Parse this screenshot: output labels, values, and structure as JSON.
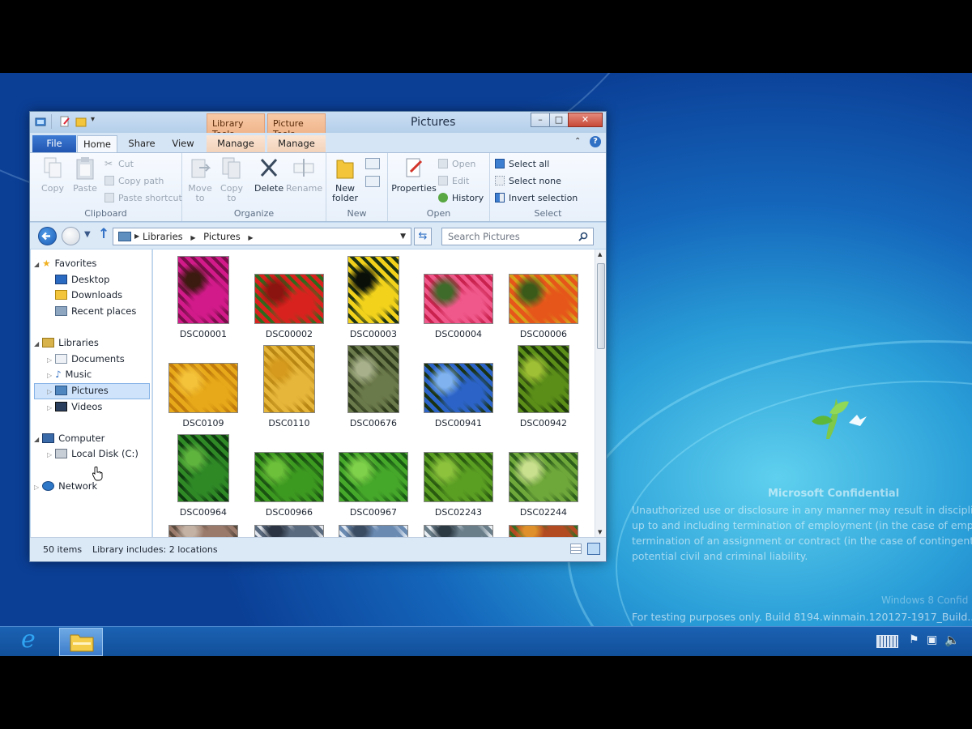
{
  "window": {
    "title": "Pictures",
    "context_tabs": [
      "Library Tools",
      "Picture Tools"
    ],
    "buttons": {
      "minimize": "–",
      "maximize": "□",
      "close": "✕"
    }
  },
  "tabs": {
    "file": "File",
    "home": "Home",
    "share": "Share",
    "view": "View",
    "manage1": "Manage",
    "manage2": "Manage"
  },
  "ribbon": {
    "clipboard": {
      "label": "Clipboard",
      "copy": "Copy",
      "paste": "Paste",
      "cut": "Cut",
      "copy_path": "Copy path",
      "paste_shortcut": "Paste shortcut"
    },
    "organize": {
      "label": "Organize",
      "move_to": "Move to",
      "copy_to": "Copy to",
      "delete": "Delete",
      "rename": "Rename"
    },
    "new": {
      "label": "New",
      "new_folder": "New folder"
    },
    "open": {
      "label": "Open",
      "properties": "Properties",
      "open": "Open",
      "edit": "Edit",
      "history": "History"
    },
    "select": {
      "label": "Select",
      "select_all": "Select all",
      "select_none": "Select none",
      "invert": "Invert selection"
    }
  },
  "address": {
    "crumbs": [
      "Libraries",
      "Pictures"
    ],
    "search_placeholder": "Search Pictures"
  },
  "nav": {
    "favorites": "Favorites",
    "desktop": "Desktop",
    "downloads": "Downloads",
    "recent": "Recent places",
    "libraries": "Libraries",
    "documents": "Documents",
    "music": "Music",
    "pictures": "Pictures",
    "videos": "Videos",
    "computer": "Computer",
    "local_disk": "Local Disk (C:)",
    "network": "Network"
  },
  "files": [
    {
      "name": "DSC00001",
      "colors": [
        "#d21a8a",
        "#7a0e4a",
        "#3b1a0f"
      ]
    },
    {
      "name": "DSC00002",
      "colors": [
        "#d8221e",
        "#2f6a1c",
        "#8c1410"
      ]
    },
    {
      "name": "DSC00003",
      "colors": [
        "#f2d21a",
        "#1e3312",
        "#0a0f08"
      ]
    },
    {
      "name": "DSC00004",
      "colors": [
        "#f0578a",
        "#c9224e",
        "#3f6b2a"
      ]
    },
    {
      "name": "DSC00006",
      "colors": [
        "#e6561a",
        "#d7a21b",
        "#3a5a1a"
      ]
    },
    {
      "name": "DSC0109",
      "colors": [
        "#e7a919",
        "#c07b0c",
        "#f4c33a"
      ]
    },
    {
      "name": "DSC0110",
      "colors": [
        "#e5b63a",
        "#b88613",
        "#d69b1e"
      ]
    },
    {
      "name": "DSC00676",
      "colors": [
        "#6b7a4a",
        "#2e3a1c",
        "#a7b08a"
      ]
    },
    {
      "name": "DSC00941",
      "colors": [
        "#2b63c7",
        "#1a3212",
        "#7fb2ee"
      ]
    },
    {
      "name": "DSC00942",
      "colors": [
        "#5a8e18",
        "#1e3a0a",
        "#9fc034"
      ]
    },
    {
      "name": "DSC00964",
      "colors": [
        "#2f8a26",
        "#0e3a10",
        "#5fb43e"
      ]
    },
    {
      "name": "DSC00966",
      "colors": [
        "#3d9a20",
        "#1a5212",
        "#6cc03a"
      ]
    },
    {
      "name": "DSC00967",
      "colors": [
        "#46a82a",
        "#195a14",
        "#7fd04a"
      ]
    },
    {
      "name": "DSC02243",
      "colors": [
        "#5a9e22",
        "#2a5a10",
        "#8cc23c"
      ]
    },
    {
      "name": "DSC02244",
      "colors": [
        "#6fa83a",
        "#2e5e1c",
        "#c9e08e"
      ]
    },
    {
      "name": "",
      "colors": [
        "#9a7a6a",
        "#5a4a3e",
        "#c4b2a4"
      ]
    },
    {
      "name": "",
      "colors": [
        "#5a6a7e",
        "#e0e4ea",
        "#2a3442"
      ]
    },
    {
      "name": "",
      "colors": [
        "#6a8ab2",
        "#dfe8f2",
        "#3a4c62"
      ]
    },
    {
      "name": "",
      "colors": [
        "#6a7e8a",
        "#e8eef2",
        "#2c3a44"
      ]
    },
    {
      "name": "",
      "colors": [
        "#b24a22",
        "#3a6a22",
        "#e0902a"
      ]
    }
  ],
  "status": {
    "count": "50 items",
    "library": "Library includes: 2 locations"
  },
  "watermark": {
    "title": "Microsoft Confidential",
    "lines": [
      "Unauthorized use or disclosure in any manner may result in disciplin",
      "up to and including termination of employment (in the case of empl",
      "termination of an assignment or contract (in the case of contingent s",
      "potential civil and criminal liability."
    ],
    "right": "Windows 8 Confid",
    "build": "For testing purposes only. Build 8194.winmain.120127-1917_Build..."
  },
  "accent": "#2156b1"
}
